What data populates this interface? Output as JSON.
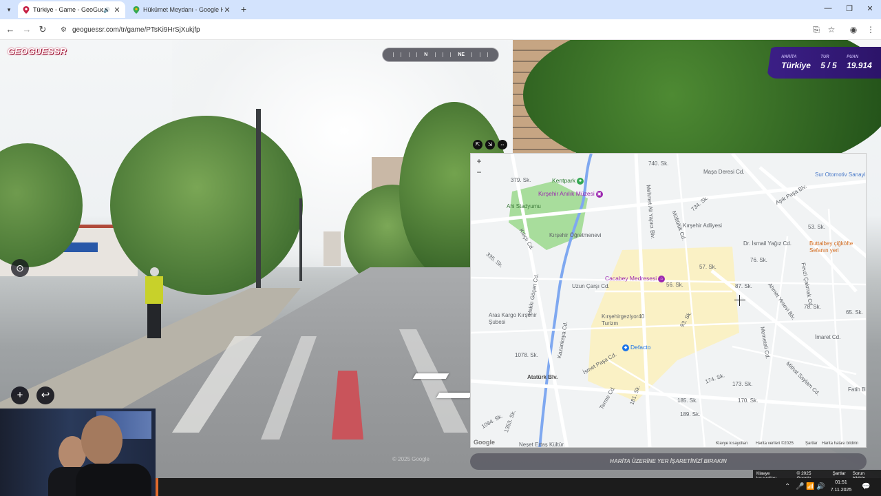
{
  "browser": {
    "tabs": [
      {
        "title": "Türkiye - Game - GeoGuessr",
        "active": true,
        "favicon": "geoguessr-pin-icon"
      },
      {
        "title": "Hükümet Meydanı - Google Haritalar",
        "active": false,
        "favicon": "google-maps-icon"
      }
    ],
    "url": "geoguessr.com/tr/game/PTsKi9HrSjXukjfp"
  },
  "game": {
    "logo": "GEOGUESSR",
    "compass": {
      "n": "N",
      "ne": "NE"
    },
    "status": {
      "map_label": "HARİTA",
      "map_value": "Türkiye",
      "round_label": "TUR",
      "round_value": "5 / 5",
      "score_label": "PUAN",
      "score_value": "19.914"
    },
    "guess_button": "HARİTA ÜZERİNE YER İŞARETİNİZİ BIRAKIN",
    "streetview_copyright": "© 2025 Google",
    "streetview_footer": [
      "Klavye kısayolları",
      "© 2025 Google",
      "Şartlar",
      "Sorun bildirin"
    ]
  },
  "map": {
    "zoom_in": "+",
    "zoom_out": "−",
    "labels": [
      "740. Sk.",
      "Maşa Deresi Cd.",
      "Aşık Paşa Blv.",
      "Sur Otomotiv Sanayi",
      "Mehmet Ali Yapıcı Blv.",
      "379. Sk.",
      "Müftülük Cd.",
      "734. Sk.",
      "Kırşehir Adliyesi",
      "53. Sk.",
      "Ahi Stadyumu",
      "Kırşehir Öğretmenevi",
      "Dr. İsmail Yağız Cd.",
      "Buttalbey çiğköfte Sefanın yeri",
      "Kılıçlı Cd.",
      "335. Sk.",
      "57. Sk.",
      "76. Sk.",
      "Hakkı Göçen Cd.",
      "Uzun Çarşı Cd.",
      "56. Sk.",
      "87. Sk.",
      "Ahmet Yesevi Blv.",
      "78. Sk.",
      "Aras Kargo Kırşehir Şubesi",
      "Kırşehirgeziyor40 Turizm",
      "93. Sk.",
      "Fevzi Çakmak Cd.",
      "65. Sk.",
      "Kazankaya Cd.",
      "1078. Sk.",
      "Memeteli Cd.",
      "İmaret Cd.",
      "Atatürk Blv.",
      "İsmet Paşa Cd.",
      "Terme Cd.",
      "181. Sk.",
      "174. Sk.",
      "173. Sk.",
      "170. Sk.",
      "Mithat Saylam Cd.",
      "1084. Sk.",
      "1353. Sk.",
      "Neşet Ertaş Kültür",
      "185. Sk.",
      "189. Sk.",
      "Fatih Blv.",
      "Kentpark",
      "Kırşehir Anılık Müzesi",
      "Cacabey Medresesi",
      "Defacto"
    ],
    "footer": [
      "Klavye kısayolları",
      "Harita verileri ©2025",
      "Şartlar",
      "Harita hatası bildirin"
    ],
    "google_logo": "Google"
  },
  "taskbar": {
    "time": "01:51",
    "date": "7.11.2025"
  },
  "colors": {
    "status_bg": "#2c1469",
    "map_green": "#9fdc95",
    "map_water": "#7fa8f0",
    "map_yellow": "#fbf1c0",
    "guess_btn": "#5a5a64"
  }
}
